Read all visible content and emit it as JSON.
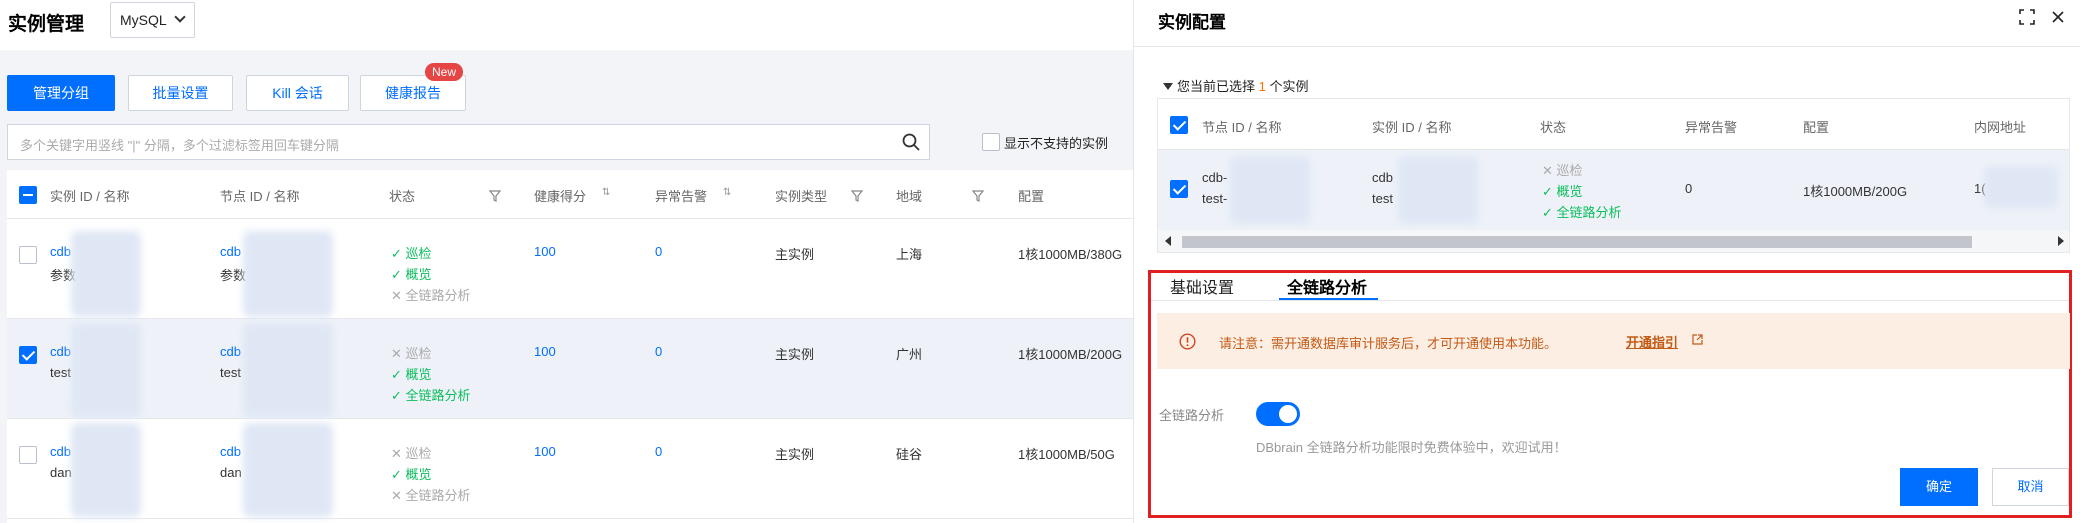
{
  "page": {
    "title": "实例管理",
    "db_type": "MySQL"
  },
  "toolbar": {
    "manage_group": "管理分组",
    "batch_settings": "批量设置",
    "kill_session": "Kill 会话",
    "health_report": "健康报告",
    "new_badge": "New"
  },
  "search": {
    "placeholder": "多个关键字用竖线 \"|\" 分隔，多个过滤标签用回车键分隔",
    "show_unsupported": "显示不支持的实例"
  },
  "table": {
    "headers": {
      "instance": "实例 ID / 名称",
      "node": "节点 ID / 名称",
      "status": "状态",
      "health": "健康得分",
      "alarm": "异常告警",
      "type": "实例类型",
      "region": "地域",
      "config": "配置"
    },
    "rows": [
      {
        "instance_id": "cdb",
        "instance_name": "参数",
        "node_id": "cdb",
        "node_name": "参数",
        "status": [
          {
            "label": "巡检",
            "enabled": true
          },
          {
            "label": "概览",
            "enabled": true
          },
          {
            "label": "全链路分析",
            "enabled": false
          }
        ],
        "health": "100",
        "alarm": "0",
        "type": "主实例",
        "region": "上海",
        "config": "1核1000MB/380G",
        "selected": false
      },
      {
        "instance_id": "cdb",
        "instance_name": "test",
        "node_id": "cdb",
        "node_name": "test",
        "status": [
          {
            "label": "巡检",
            "enabled": false
          },
          {
            "label": "概览",
            "enabled": true
          },
          {
            "label": "全链路分析",
            "enabled": true
          }
        ],
        "health": "100",
        "alarm": "0",
        "type": "主实例",
        "region": "广州",
        "config": "1核1000MB/200G",
        "selected": true
      },
      {
        "instance_id": "cdb",
        "instance_name": "dan",
        "node_id": "cdb",
        "node_name": "dan",
        "status": [
          {
            "label": "巡检",
            "enabled": false
          },
          {
            "label": "概览",
            "enabled": true
          },
          {
            "label": "全链路分析",
            "enabled": false
          }
        ],
        "health": "100",
        "alarm": "0",
        "type": "主实例",
        "region": "硅谷",
        "config": "1核1000MB/50G",
        "selected": false
      }
    ]
  },
  "drawer": {
    "title": "实例配置",
    "selection_prefix": "您当前已选择",
    "selection_count": "1",
    "selection_suffix": "个实例",
    "subtable": {
      "headers": {
        "node": "节点 ID / 名称",
        "instance": "实例 ID / 名称",
        "status": "状态",
        "alarm": "异常告警",
        "config": "配置",
        "ip": "内网地址"
      },
      "row": {
        "node_id": "cdb-",
        "node_name": "test-",
        "instance_id": "cdb",
        "instance_name": "test",
        "status": [
          {
            "label": "巡检",
            "enabled": false
          },
          {
            "label": "概览",
            "enabled": true
          },
          {
            "label": "全链路分析",
            "enabled": true
          }
        ],
        "alarm": "0",
        "config": "1核1000MB/200G",
        "ip": "1("
      }
    },
    "tabs": [
      "基础设置",
      "全链路分析"
    ],
    "active_tab": "全链路分析",
    "notice": {
      "text": "请注意：需开通数据库审计服务后，才可开通使用本功能。",
      "link": "开通指引"
    },
    "field_label": "全链路分析",
    "toggle_on": true,
    "helper": "DBbrain 全链路分析功能限时免费体验中，欢迎试用！",
    "confirm": "确定",
    "cancel": "取消"
  },
  "colors": {
    "primary": "#006eff",
    "success": "#0abf5b",
    "warning_text": "#c15a14",
    "warning_bg": "#fdeee4",
    "highlight": "#e02020",
    "badge": "#e54545"
  }
}
